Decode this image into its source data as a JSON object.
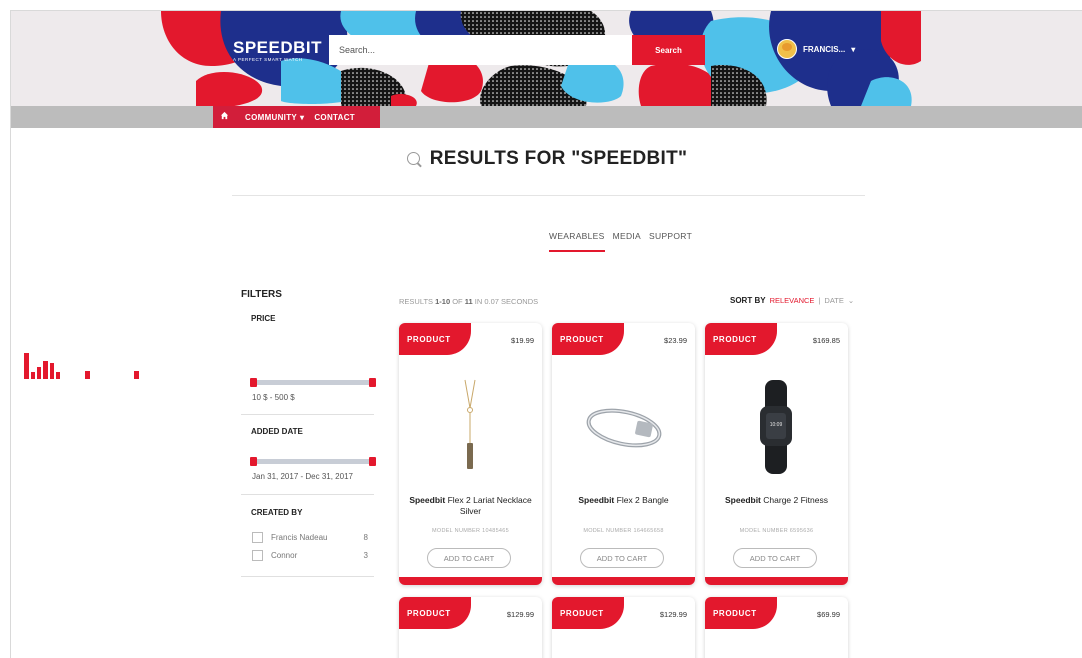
{
  "header": {
    "logo": "SPEEDBIT",
    "tagline": "A PERFECT SMART WATCH",
    "search_placeholder": "Search...",
    "search_button": "Search",
    "user_name": "FRANCIS...",
    "user_caret": "▾"
  },
  "nav": {
    "home_icon": "home-icon",
    "items": [
      {
        "label": "COMMUNITY",
        "caret": "▾"
      },
      {
        "label": "CONTACT",
        "caret": ""
      }
    ]
  },
  "page": {
    "title": "RESULTS FOR \"SPEEDBIT\"",
    "tabs": [
      "WEARABLES",
      "MEDIA",
      "SUPPORT"
    ],
    "active_tab": "WEARABLES"
  },
  "filters": {
    "title": "FILTERS",
    "price": {
      "label": "PRICE",
      "range": "10 $ - 500 $"
    },
    "added_date": {
      "label": "ADDED DATE",
      "range": "Jan 31, 2017 - Dec 31, 2017"
    },
    "created_by": {
      "label": "CREATED BY",
      "options": [
        {
          "name": "Francis Nadeau",
          "count": "8"
        },
        {
          "name": "Connor",
          "count": "3"
        }
      ]
    }
  },
  "results": {
    "info_prefix": "RESULTS ",
    "info_range": "1-10",
    "info_of": " OF ",
    "info_total": "11",
    "info_suffix": " IN 0.07 SECONDS",
    "sort_label": "SORT BY",
    "sort_active": "RELEVANCE",
    "sort_sep": "|",
    "sort_other": "DATE",
    "sort_caret": "⌄"
  },
  "products": [
    {
      "badge": "PRODUCT",
      "price": "$19.99",
      "brand": "Speedbit",
      "name": " Flex 2 Lariat Necklace Silver",
      "model": "MODEL NUMBER  10485465",
      "cart": "ADD TO CART"
    },
    {
      "badge": "PRODUCT",
      "price": "$23.99",
      "brand": "Speedbit",
      "name": " Flex 2 Bangle",
      "model": "MODEL NUMBER  164665658",
      "cart": "ADD TO CART"
    },
    {
      "badge": "PRODUCT",
      "price": "$169.85",
      "brand": "Speedbit",
      "name": " Charge 2 Fitness",
      "model": "MODEL NUMBER  6595636",
      "cart": "ADD TO CART"
    },
    {
      "badge": "PRODUCT",
      "price": "$129.99"
    },
    {
      "badge": "PRODUCT",
      "price": "$129.99"
    },
    {
      "badge": "PRODUCT",
      "price": "$69.99"
    }
  ],
  "colors": {
    "accent": "#e3182d",
    "nav_gray": "#bcbcbc"
  }
}
